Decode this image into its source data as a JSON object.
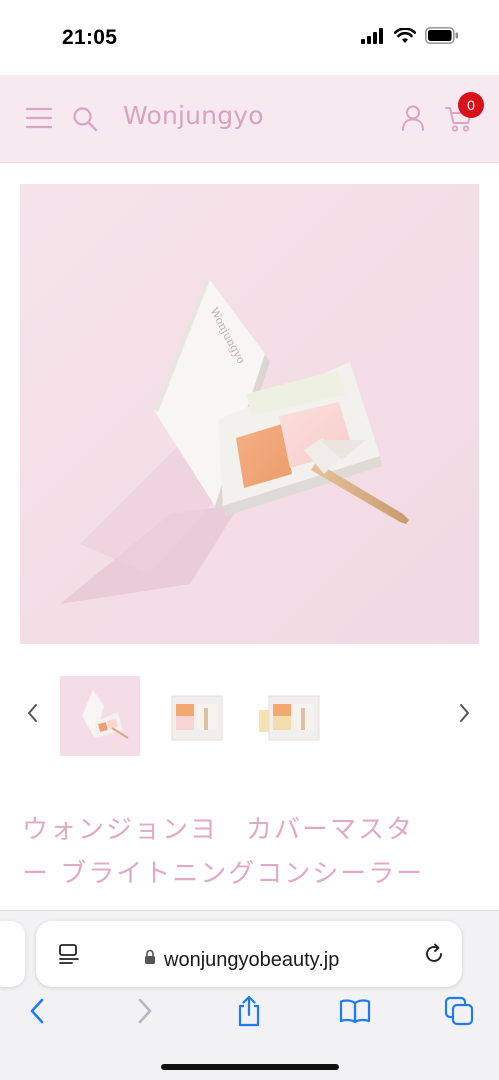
{
  "status_bar": {
    "time": "21:05"
  },
  "header": {
    "brand": "Wonjungyo",
    "cart_count": "0",
    "menu_icon": "hamburger-icon",
    "search_icon": "search-icon",
    "account_icon": "user-icon",
    "cart_icon": "cart-icon"
  },
  "hero": {
    "image": "concealer-palette-photo"
  },
  "gallery": {
    "thumbnails": [
      "thumb-1",
      "thumb-2",
      "thumb-3"
    ],
    "active_index": 0
  },
  "product": {
    "title_line1": "ウォンジョンヨ　カバーマスタ",
    "title_line2": "ー ブライトニングコンシーラー"
  },
  "browser": {
    "url": "wonjungyobeauty.jp",
    "lock_icon": "lock-icon",
    "reader_icon": "reader-icon",
    "reload_icon": "reload-icon",
    "toolbar": [
      "back-icon",
      "forward-icon",
      "share-icon",
      "bookmarks-icon",
      "tabs-icon"
    ]
  },
  "colors": {
    "accent": "#dba4c2",
    "header_bg": "#f6e9f0",
    "badge": "#d8111b",
    "link_blue": "#1e7cf0"
  }
}
